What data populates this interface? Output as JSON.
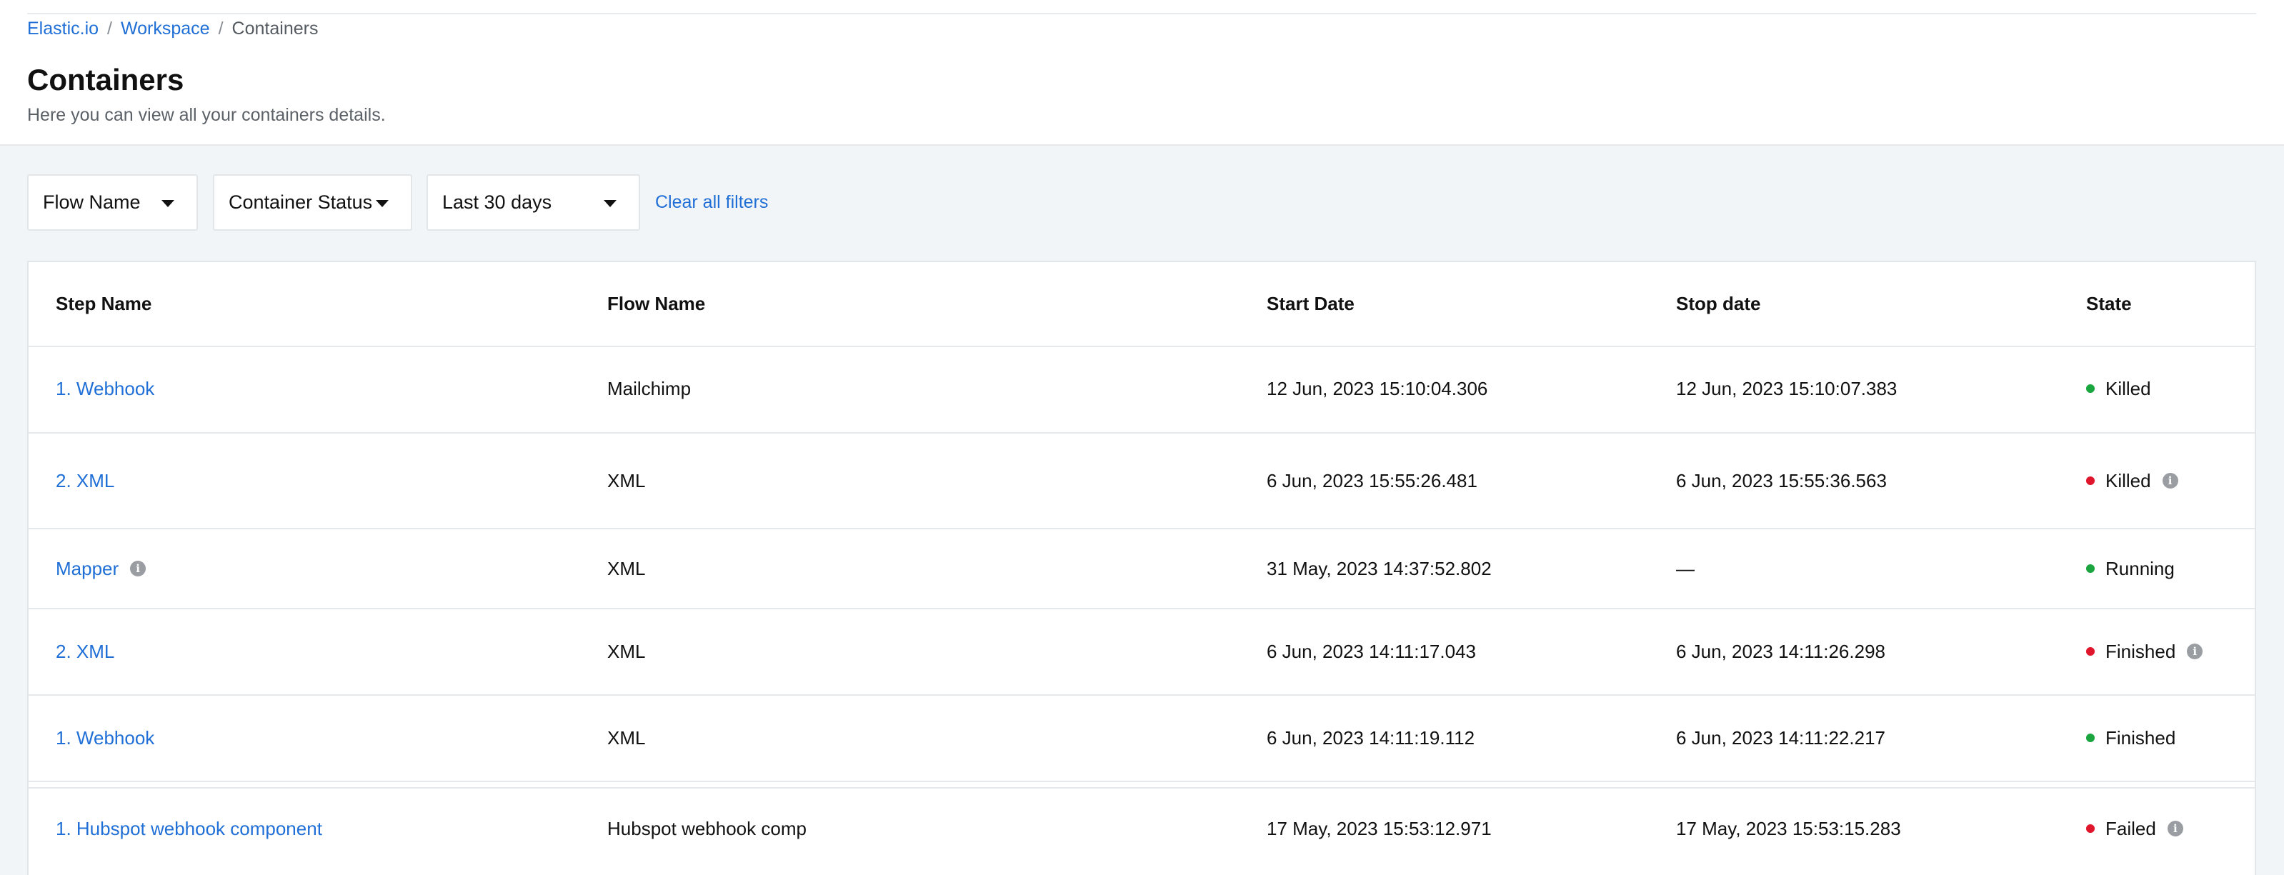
{
  "breadcrumb": {
    "items": [
      "Elastic.io",
      "Workspace"
    ],
    "separator": "/",
    "current": "Containers"
  },
  "page": {
    "title": "Containers",
    "subtitle": "Here you can view all your containers details."
  },
  "filters": {
    "flow_name": "Flow Name",
    "container_status": "Container Status",
    "date_range": "Last 30 days",
    "clear_all": "Clear all filters"
  },
  "table": {
    "columns": [
      "Step Name",
      "Flow Name",
      "Start Date",
      "Stop date",
      "State"
    ],
    "rows": [
      {
        "step": "1. Webhook",
        "flow": "Mailchimp",
        "start": "12 Jun, 2023 15:10:04.306",
        "stop": "12 Jun, 2023 15:10:07.383",
        "state": "Killed",
        "state_color": "#1aa53f",
        "step_info": false,
        "state_info": false
      },
      {
        "step": "2. XML",
        "flow": "XML",
        "start": "6 Jun, 2023 15:55:26.481",
        "stop": "6 Jun, 2023 15:55:36.563",
        "state": "Killed",
        "state_color": "#e0142a",
        "step_info": false,
        "state_info": true
      },
      {
        "step": "Mapper",
        "flow": "XML",
        "start": "31 May, 2023 14:37:52.802",
        "stop": "—",
        "state": "Running",
        "state_color": "#1aa53f",
        "step_info": true,
        "state_info": false
      },
      {
        "step": "2. XML",
        "flow": "XML",
        "start": "6 Jun, 2023 14:11:17.043",
        "stop": "6 Jun, 2023 14:11:26.298",
        "state": "Finished",
        "state_color": "#e0142a",
        "step_info": false,
        "state_info": true
      },
      {
        "step": "1. Webhook",
        "flow": "XML",
        "start": "6 Jun, 2023 14:11:19.112",
        "stop": "6 Jun, 2023 14:11:22.217",
        "state": "Finished",
        "state_color": "#1aa53f",
        "step_info": false,
        "state_info": false
      },
      {
        "step": "1. Hubspot webhook component",
        "flow": "Hubspot webhook comp",
        "start": "17 May, 2023 15:53:12.971",
        "stop": "17 May, 2023 15:53:15.283",
        "state": "Failed",
        "state_color": "#e0142a",
        "step_info": false,
        "state_info": true
      }
    ]
  },
  "icons": {
    "info": "info-icon",
    "dropdown": "caret-down-icon"
  },
  "colors": {
    "link": "#1f6fd6",
    "success": "#1aa53f",
    "error": "#e0142a",
    "background": "#f2f5f7"
  }
}
